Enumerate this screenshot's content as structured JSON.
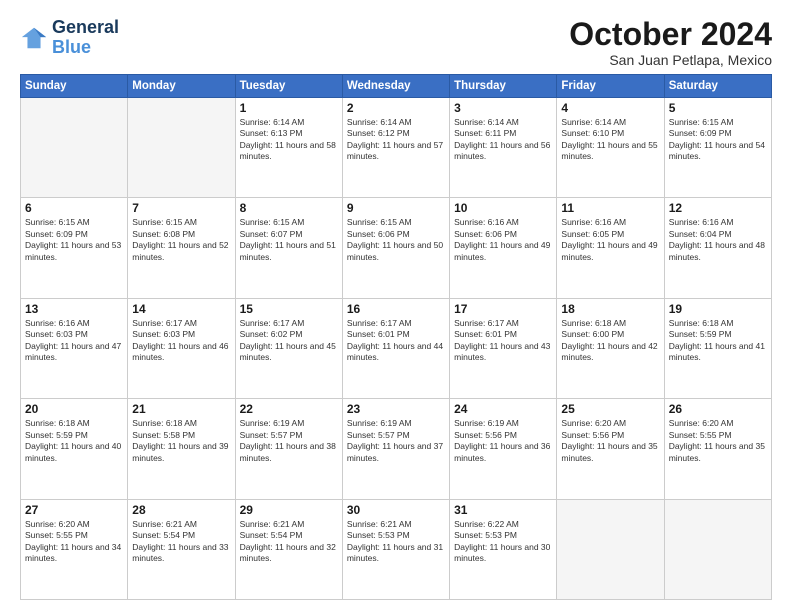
{
  "logo": {
    "line1": "General",
    "line2": "Blue"
  },
  "title": "October 2024",
  "location": "San Juan Petlapa, Mexico",
  "days_header": [
    "Sunday",
    "Monday",
    "Tuesday",
    "Wednesday",
    "Thursday",
    "Friday",
    "Saturday"
  ],
  "weeks": [
    [
      {
        "day": "",
        "info": ""
      },
      {
        "day": "",
        "info": ""
      },
      {
        "day": "1",
        "info": "Sunrise: 6:14 AM\nSunset: 6:13 PM\nDaylight: 11 hours and 58 minutes."
      },
      {
        "day": "2",
        "info": "Sunrise: 6:14 AM\nSunset: 6:12 PM\nDaylight: 11 hours and 57 minutes."
      },
      {
        "day": "3",
        "info": "Sunrise: 6:14 AM\nSunset: 6:11 PM\nDaylight: 11 hours and 56 minutes."
      },
      {
        "day": "4",
        "info": "Sunrise: 6:14 AM\nSunset: 6:10 PM\nDaylight: 11 hours and 55 minutes."
      },
      {
        "day": "5",
        "info": "Sunrise: 6:15 AM\nSunset: 6:09 PM\nDaylight: 11 hours and 54 minutes."
      }
    ],
    [
      {
        "day": "6",
        "info": "Sunrise: 6:15 AM\nSunset: 6:09 PM\nDaylight: 11 hours and 53 minutes."
      },
      {
        "day": "7",
        "info": "Sunrise: 6:15 AM\nSunset: 6:08 PM\nDaylight: 11 hours and 52 minutes."
      },
      {
        "day": "8",
        "info": "Sunrise: 6:15 AM\nSunset: 6:07 PM\nDaylight: 11 hours and 51 minutes."
      },
      {
        "day": "9",
        "info": "Sunrise: 6:15 AM\nSunset: 6:06 PM\nDaylight: 11 hours and 50 minutes."
      },
      {
        "day": "10",
        "info": "Sunrise: 6:16 AM\nSunset: 6:06 PM\nDaylight: 11 hours and 49 minutes."
      },
      {
        "day": "11",
        "info": "Sunrise: 6:16 AM\nSunset: 6:05 PM\nDaylight: 11 hours and 49 minutes."
      },
      {
        "day": "12",
        "info": "Sunrise: 6:16 AM\nSunset: 6:04 PM\nDaylight: 11 hours and 48 minutes."
      }
    ],
    [
      {
        "day": "13",
        "info": "Sunrise: 6:16 AM\nSunset: 6:03 PM\nDaylight: 11 hours and 47 minutes."
      },
      {
        "day": "14",
        "info": "Sunrise: 6:17 AM\nSunset: 6:03 PM\nDaylight: 11 hours and 46 minutes."
      },
      {
        "day": "15",
        "info": "Sunrise: 6:17 AM\nSunset: 6:02 PM\nDaylight: 11 hours and 45 minutes."
      },
      {
        "day": "16",
        "info": "Sunrise: 6:17 AM\nSunset: 6:01 PM\nDaylight: 11 hours and 44 minutes."
      },
      {
        "day": "17",
        "info": "Sunrise: 6:17 AM\nSunset: 6:01 PM\nDaylight: 11 hours and 43 minutes."
      },
      {
        "day": "18",
        "info": "Sunrise: 6:18 AM\nSunset: 6:00 PM\nDaylight: 11 hours and 42 minutes."
      },
      {
        "day": "19",
        "info": "Sunrise: 6:18 AM\nSunset: 5:59 PM\nDaylight: 11 hours and 41 minutes."
      }
    ],
    [
      {
        "day": "20",
        "info": "Sunrise: 6:18 AM\nSunset: 5:59 PM\nDaylight: 11 hours and 40 minutes."
      },
      {
        "day": "21",
        "info": "Sunrise: 6:18 AM\nSunset: 5:58 PM\nDaylight: 11 hours and 39 minutes."
      },
      {
        "day": "22",
        "info": "Sunrise: 6:19 AM\nSunset: 5:57 PM\nDaylight: 11 hours and 38 minutes."
      },
      {
        "day": "23",
        "info": "Sunrise: 6:19 AM\nSunset: 5:57 PM\nDaylight: 11 hours and 37 minutes."
      },
      {
        "day": "24",
        "info": "Sunrise: 6:19 AM\nSunset: 5:56 PM\nDaylight: 11 hours and 36 minutes."
      },
      {
        "day": "25",
        "info": "Sunrise: 6:20 AM\nSunset: 5:56 PM\nDaylight: 11 hours and 35 minutes."
      },
      {
        "day": "26",
        "info": "Sunrise: 6:20 AM\nSunset: 5:55 PM\nDaylight: 11 hours and 35 minutes."
      }
    ],
    [
      {
        "day": "27",
        "info": "Sunrise: 6:20 AM\nSunset: 5:55 PM\nDaylight: 11 hours and 34 minutes."
      },
      {
        "day": "28",
        "info": "Sunrise: 6:21 AM\nSunset: 5:54 PM\nDaylight: 11 hours and 33 minutes."
      },
      {
        "day": "29",
        "info": "Sunrise: 6:21 AM\nSunset: 5:54 PM\nDaylight: 11 hours and 32 minutes."
      },
      {
        "day": "30",
        "info": "Sunrise: 6:21 AM\nSunset: 5:53 PM\nDaylight: 11 hours and 31 minutes."
      },
      {
        "day": "31",
        "info": "Sunrise: 6:22 AM\nSunset: 5:53 PM\nDaylight: 11 hours and 30 minutes."
      },
      {
        "day": "",
        "info": ""
      },
      {
        "day": "",
        "info": ""
      }
    ]
  ]
}
